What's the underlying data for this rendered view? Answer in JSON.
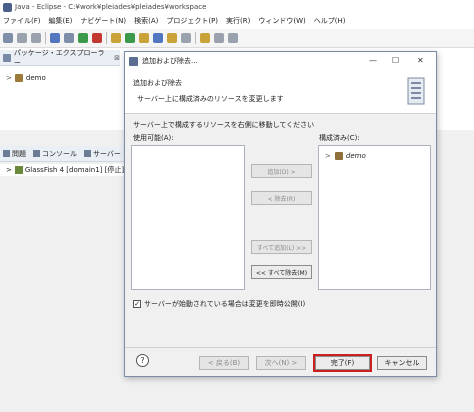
{
  "window": {
    "title": "Java - Eclipse - C:¥work¥pleiades¥pleiades¥workspace"
  },
  "menubar": [
    "ファイル(F)",
    "編集(E)",
    "ナビゲート(N)",
    "検索(A)",
    "プロジェクト(P)",
    "実行(R)",
    "ウィンドウ(W)",
    "ヘルプ(H)"
  ],
  "explorer": {
    "tab_label": "パッケージ・エクスプローラー",
    "close_glyph": "⊠",
    "project": "demo"
  },
  "bottom_views": {
    "tabs": [
      "問題",
      "コンソール",
      "サーバー"
    ],
    "server_entry": "GlassFish 4 [domain1] [停止]"
  },
  "dialog": {
    "title": "追加および除去...",
    "header_title": "追加および除去",
    "header_desc": "サーバー上に構成済みのリソースを変更します",
    "instruction": "サーバー上で構成するリソースを右側に移動してください",
    "available_label": "使用可能(A):",
    "configured_label": "構成済み(C):",
    "configured_items": [
      "demo"
    ],
    "buttons": {
      "add": "追加(D) >",
      "remove": "< 除去(R)",
      "add_all": "すべて追加(L) >>",
      "remove_all": "<< すべて除去(M)"
    },
    "publish_checkbox": {
      "label": "サーバーが始動されている場合は変更を即時公開(I)",
      "checked": true
    },
    "footer": {
      "help": "?",
      "back": "< 戻る(B)",
      "next": "次へ(N) >",
      "finish": "完了(F)",
      "cancel": "キャンセル"
    }
  }
}
